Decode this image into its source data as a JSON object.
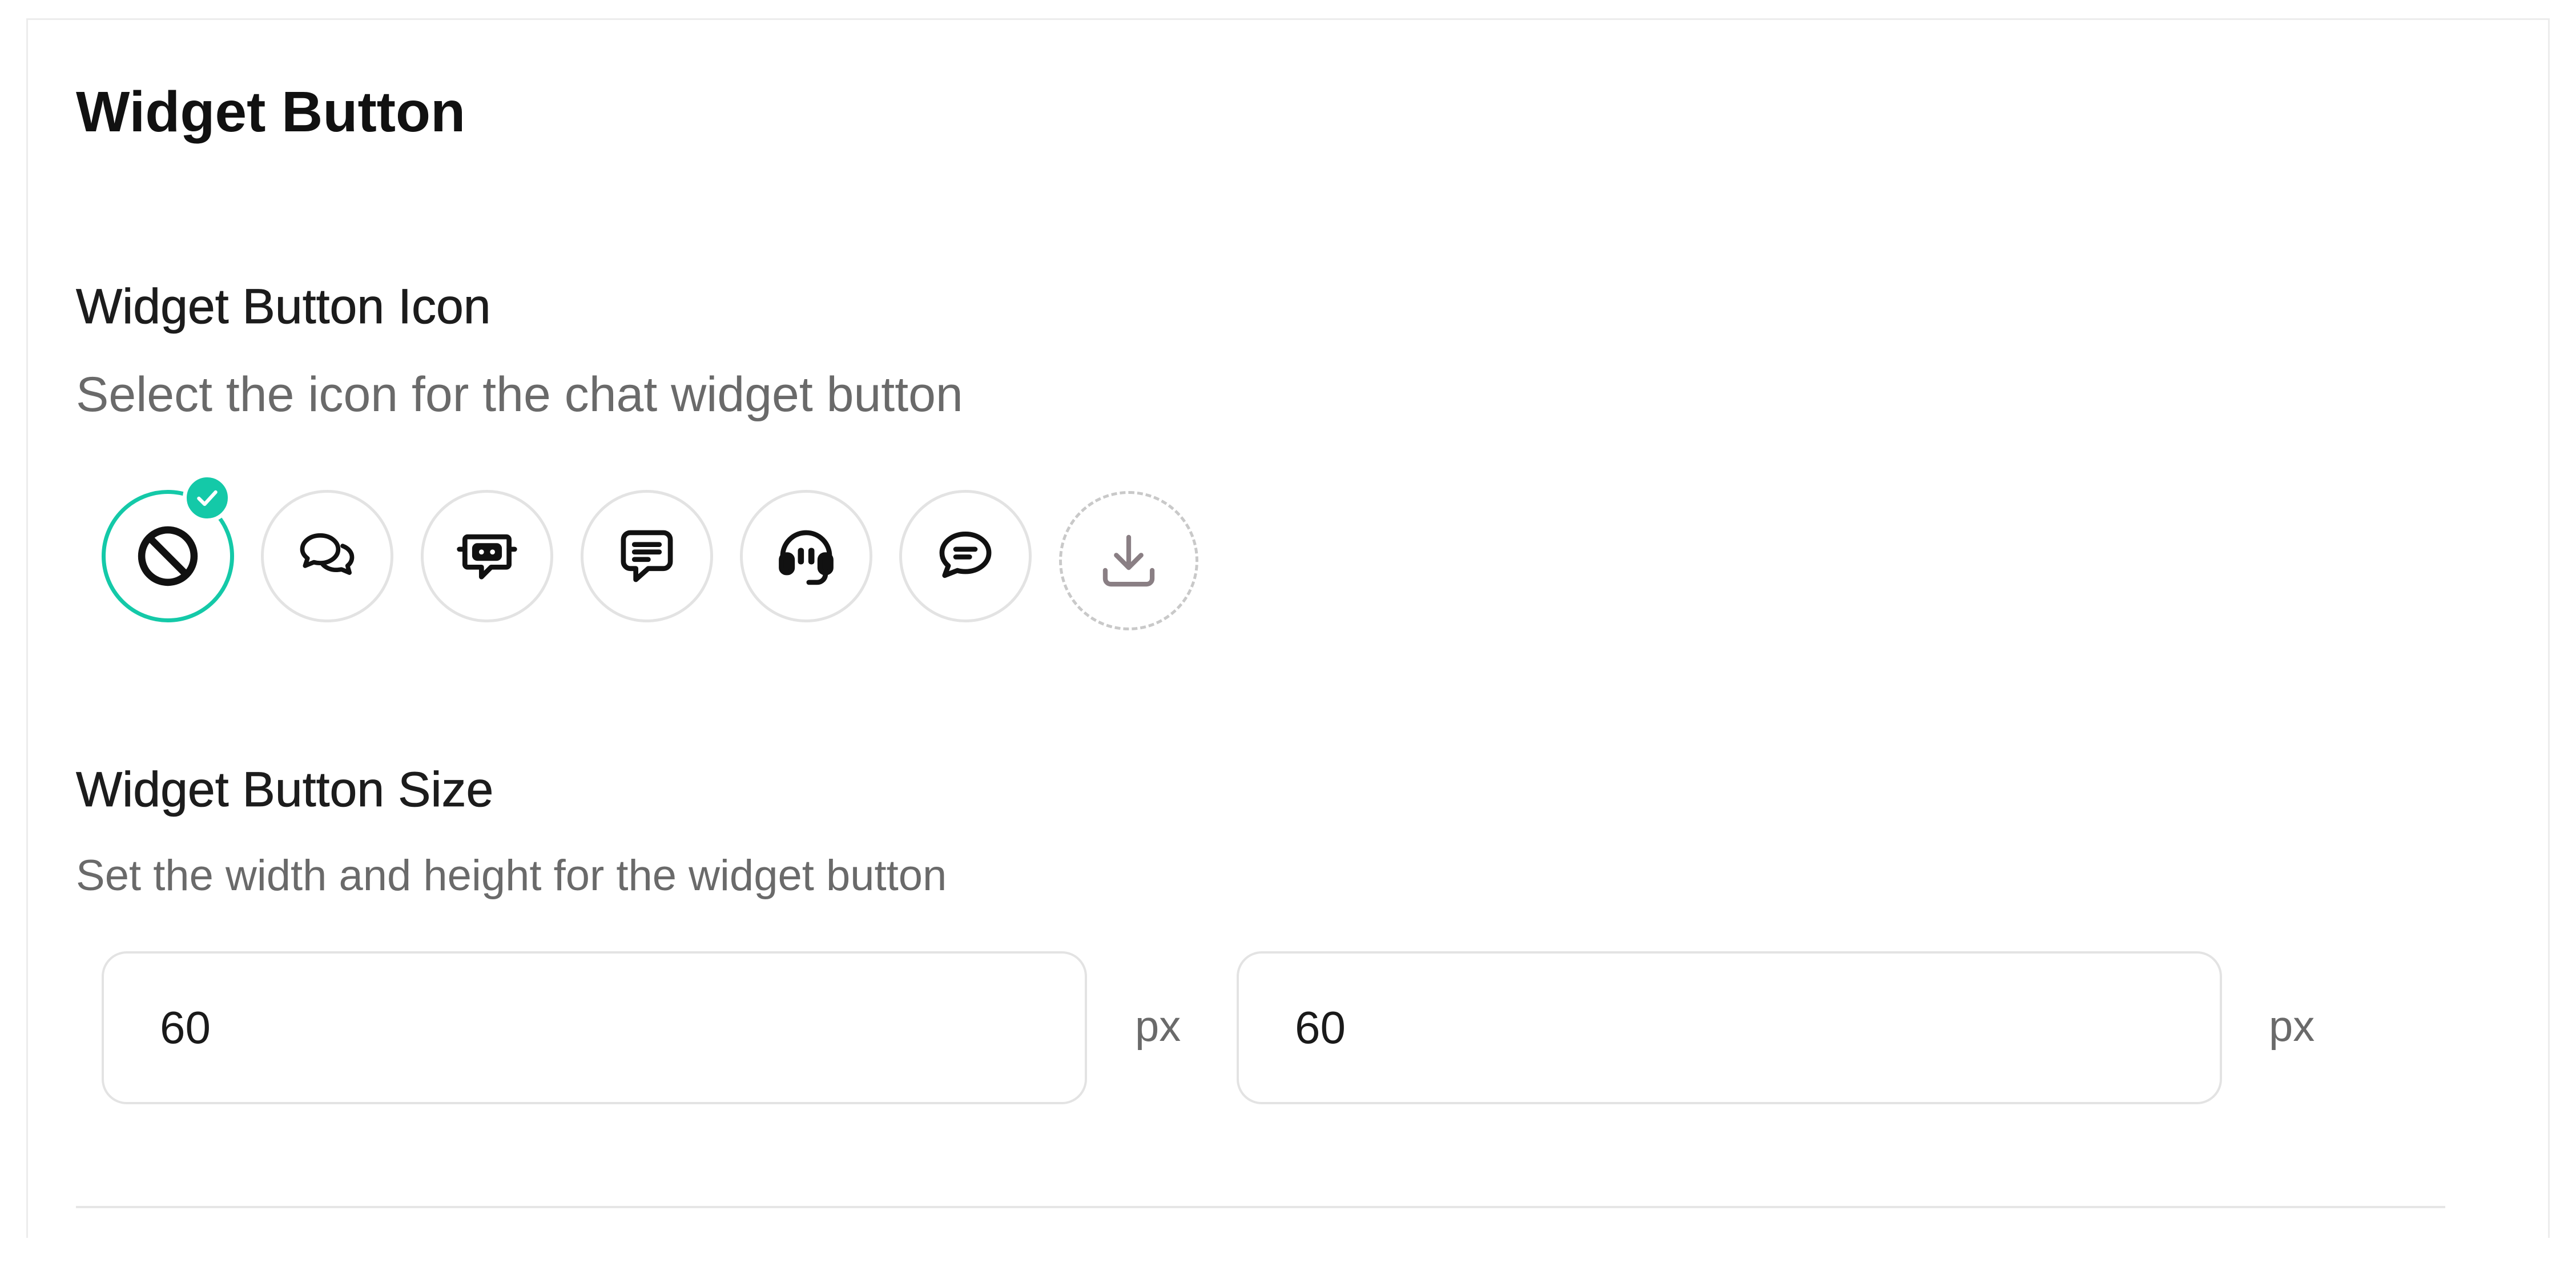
{
  "widget_button": {
    "section_title": "Widget Button",
    "icon_field": {
      "label": "Widget Button Icon",
      "description": "Select the icon for the chat widget button",
      "selected_icon": "no-icon",
      "accent_color": "#14c9a8",
      "options": [
        {
          "name": "no-icon",
          "selected": true
        },
        {
          "name": "chat-bubbles-icon",
          "selected": false
        },
        {
          "name": "bot-chat-icon",
          "selected": false
        },
        {
          "name": "message-lines-icon",
          "selected": false
        },
        {
          "name": "headset-icon",
          "selected": false
        },
        {
          "name": "speech-bubble-icon",
          "selected": false
        },
        {
          "name": "upload-icon",
          "selected": false
        }
      ]
    },
    "size_field": {
      "label": "Widget Button Size",
      "description": "Set the width and height for the widget button",
      "width_value": "60",
      "height_value": "60",
      "width_unit": "px",
      "height_unit": "px"
    }
  }
}
